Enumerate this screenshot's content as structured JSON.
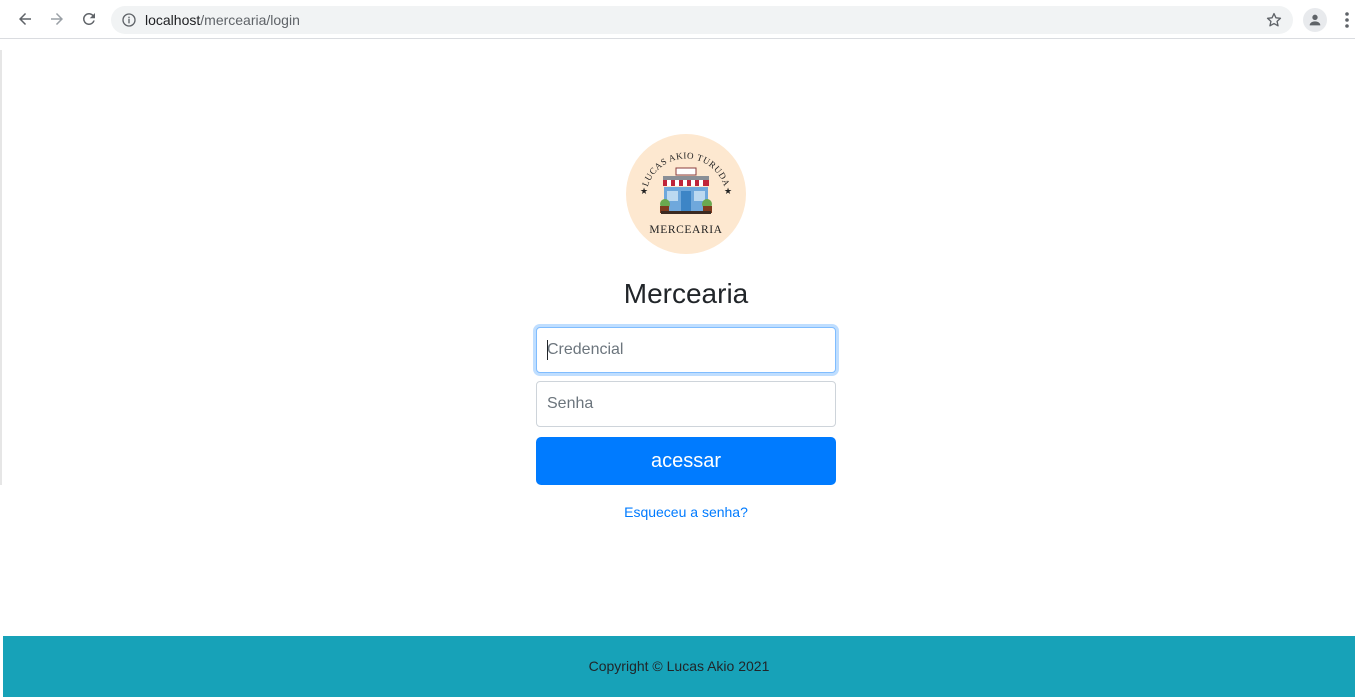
{
  "browser": {
    "url_host": "localhost",
    "url_path": "/mercearia/login",
    "icons": {
      "back": "arrow-back-icon",
      "forward": "arrow-forward-icon",
      "reload": "reload-icon",
      "info": "info-icon",
      "bookmark": "star-icon",
      "profile": "person-icon",
      "menu": "kebab-menu-icon"
    }
  },
  "logo": {
    "arc_text": "LUCAS AKIO TURUDA",
    "name_text": "MERCEARIA",
    "colors": {
      "background": "#fde8d0",
      "awning_red": "#c0253a",
      "text": "#222222"
    }
  },
  "login": {
    "title": "Mercearia",
    "credential_placeholder": "Credencial",
    "password_placeholder": "Senha",
    "submit_label": "acessar",
    "forgot_link": "Esqueceu a senha?"
  },
  "footer": {
    "copyright": "Copyright © Lucas Akio 2021"
  },
  "colors": {
    "primary": "#007bff",
    "footer_bg": "#17a2b8",
    "focus_ring": "#80bdff"
  }
}
